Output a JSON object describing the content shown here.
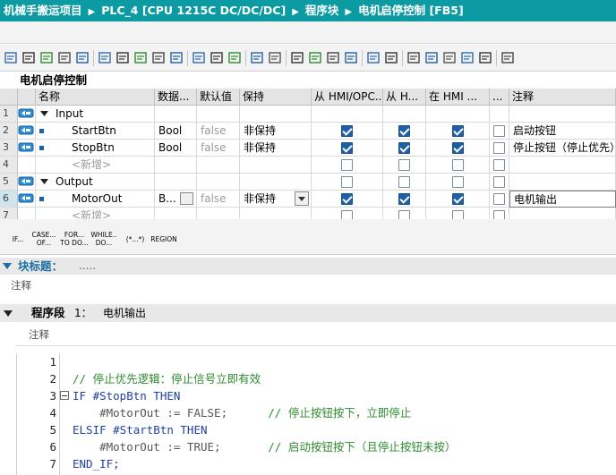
{
  "breadcrumb": [
    "机械手搬运项目",
    "PLC_4 [CPU 1215C DC/DC/DC]",
    "程序块",
    "电机启停控制 [FB5]"
  ],
  "block_name": "电机启停控制",
  "interface": {
    "columns": [
      "名称",
      "数据...",
      "默认值",
      "保持",
      "从 HMI/OPC...",
      "从 H...",
      "在 HMI ...",
      "...",
      "注释"
    ],
    "rows": [
      {
        "num": "1",
        "name": "Input",
        "type": "",
        "default": "",
        "retain": "",
        "hmi1": null,
        "hmi2": null,
        "hmi3": null,
        "setp": null,
        "comment": ""
      },
      {
        "num": "2",
        "name": "StartBtn",
        "type": "Bool",
        "default": "false",
        "retain": "非保持",
        "hmi1": true,
        "hmi2": true,
        "hmi3": true,
        "setp": false,
        "comment": "启动按钮"
      },
      {
        "num": "3",
        "name": "StopBtn",
        "type": "Bool",
        "default": "false",
        "retain": "非保持",
        "hmi1": true,
        "hmi2": true,
        "hmi3": true,
        "setp": false,
        "comment": "停止按钮（停止优先）"
      },
      {
        "num": "4",
        "name": "<新增>",
        "type": "",
        "default": "",
        "retain": "",
        "hmi1": false,
        "hmi2": false,
        "hmi3": false,
        "setp": false,
        "comment": ""
      },
      {
        "num": "5",
        "name": "Output",
        "type": "",
        "default": "",
        "retain": "",
        "hmi1": false,
        "hmi2": false,
        "hmi3": false,
        "setp": false,
        "comment": ""
      },
      {
        "num": "6",
        "name": "MotorOut",
        "type": "B...",
        "default": "false",
        "retain": "非保持",
        "hmi1": true,
        "hmi2": true,
        "hmi3": true,
        "setp": false,
        "comment": "电机输出"
      },
      {
        "num": "7",
        "name": "<新增>",
        "type": "",
        "default": "",
        "retain": "",
        "hmi1": false,
        "hmi2": false,
        "hmi3": false,
        "setp": false,
        "comment": ""
      }
    ]
  },
  "scl_buttons": [
    {
      "line1": "IF...",
      "line2": ""
    },
    {
      "line1": "CASE...",
      "line2": "OF..."
    },
    {
      "line1": "FOR...",
      "line2": "TO DO..."
    },
    {
      "line1": "WHILE..",
      "line2": "DO..."
    },
    {
      "line1": "(*...*)",
      "line2": ""
    },
    {
      "line1": "REGION",
      "line2": ""
    }
  ],
  "block_title": {
    "label": "块标题：",
    "value": "....."
  },
  "block_comment": "注释",
  "network": {
    "label": "程序段",
    "number": "1：",
    "name": "电机输出",
    "comment": "注释"
  },
  "code_lines": [
    {
      "n": "1",
      "parts": []
    },
    {
      "n": "2",
      "parts": [
        {
          "t": "// 停止优先逻辑：停止信号立即有效",
          "c": "cm"
        }
      ]
    },
    {
      "n": "3",
      "parts": [
        {
          "t": "IF #StopBtn THEN",
          "c": "kw"
        }
      ]
    },
    {
      "n": "4",
      "parts": [
        {
          "t": "    #MotorOut := FALSE;      ",
          "c": "var"
        },
        {
          "t": "// 停止按钮按下，立即停止",
          "c": "cm"
        }
      ]
    },
    {
      "n": "5",
      "parts": [
        {
          "t": "ELSIF #StartBtn THEN",
          "c": "kw"
        }
      ]
    },
    {
      "n": "6",
      "parts": [
        {
          "t": "    #MotorOut := TRUE;       ",
          "c": "var"
        },
        {
          "t": "// 启动按钮按下（且停止按钮未按）",
          "c": "cm"
        }
      ]
    },
    {
      "n": "7",
      "parts": [
        {
          "t": "END_IF;",
          "c": "kw"
        }
      ]
    }
  ],
  "colors": {
    "title_bar": "#0d9ba3",
    "keyword": "#1f3fa3",
    "comment": "#2e8b2e",
    "checkbox": "#1f5fa5"
  }
}
